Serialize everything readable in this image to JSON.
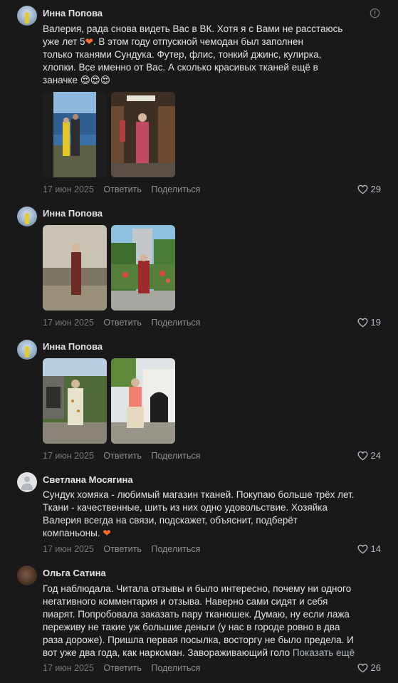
{
  "comments": [
    {
      "author": "Инна Попова",
      "lines": [
        "Валерия, рада снова видеть Вас в ВК. Хотя я с Вами не расстаюсь",
        "уже лет 5",
        ". В этом году отпускной чемодан был заполнен",
        "только тканями Сундука. Футер, флис, тонкий джинс, кулирка,",
        "хлопки. Все именно от Вас. А сколько красивых тканей ещё в",
        "заначке 😍😍😍"
      ],
      "heart_emoji": "❤",
      "date": "17 июн 2025",
      "reply": "Ответить",
      "share": "Поделиться",
      "likes": "29"
    },
    {
      "author": "Инна Попова",
      "date": "17 июн 2025",
      "reply": "Ответить",
      "share": "Поделиться",
      "likes": "19"
    },
    {
      "author": "Инна Попова",
      "date": "17 июн 2025",
      "reply": "Ответить",
      "share": "Поделиться",
      "likes": "24"
    },
    {
      "author": "Светлана Мосягина",
      "lines": [
        "Сундук хомяка - любимый магазин тканей. Покупаю больше трёх лет.",
        "Ткани - качественные, шить из них одно удовольствие. Хозяйка",
        "Валерия всегда на связи, подскажет, объяснит, подберёт",
        "компаньоны."
      ],
      "heart_emoji": "❤",
      "date": "17 июн 2025",
      "reply": "Ответить",
      "share": "Поделиться",
      "likes": "14"
    },
    {
      "author": "Ольга Сатина",
      "lines": [
        "Год наблюдала. Читала отзывы и было интересно, почему ни одного",
        "негативного комментария и отзыва. Наверно сами сидят и себя",
        "пиарят. Попробовала заказать пару тканюшек. Думаю, ну если лажа",
        "переживу не такие уж большие деньги (у нас в городе ровно в два",
        "раза дороже). Пришла первая посылка, восторгу не было предела. И",
        "вот уже два года, как наркоман. Завораживающий голо"
      ],
      "show_more": "Показать ещё",
      "date": "17 июн 2025",
      "reply": "Ответить",
      "share": "Поделиться",
      "likes": "26"
    }
  ],
  "colors": {
    "background": "#19191a",
    "text": "#e1e3e6",
    "secondary": "#76787a",
    "accent_heart": "#ff6a2b"
  }
}
